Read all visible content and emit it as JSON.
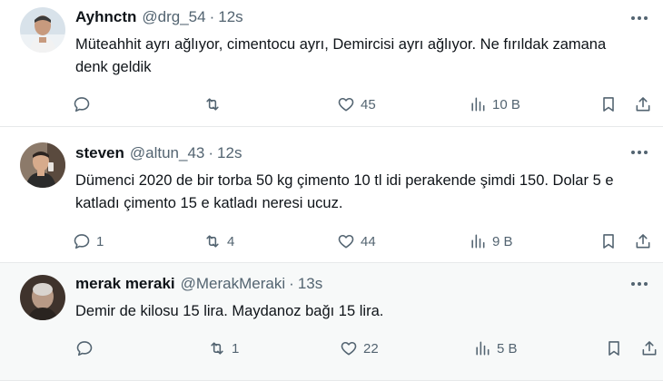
{
  "tweets": [
    {
      "name": "Ayhnctn",
      "handle": "@drg_54",
      "dot": "·",
      "time": "12s",
      "text": "Müteahhit ayrı ağlıyor, cimentocu ayrı, Demircisi ayrı ağlıyor. Ne fırıldak zamana denk geldik",
      "replies": "",
      "retweets": "",
      "likes": "45",
      "views": "10 B",
      "avatar_color": "#c9d3db"
    },
    {
      "name": "steven",
      "handle": "@altun_43",
      "dot": "·",
      "time": "12s",
      "text": "Dümenci 2020 de bir torba 50 kg çimento 10 tl idi perakende şimdi 150. Dolar 5 e katladı çimento 15 e katladı neresi ucuz.",
      "replies": "1",
      "retweets": "4",
      "likes": "44",
      "views": "9 B",
      "avatar_color": "#6b5a4c"
    },
    {
      "name": "merak meraki",
      "handle": "@MerakMeraki",
      "dot": "·",
      "time": "13s",
      "text": "Demir de kilosu 15 lira. Maydanoz bağı 15 lira.",
      "replies": "",
      "retweets": "1",
      "likes": "22",
      "views": "5 B",
      "avatar_color": "#4a3b33"
    }
  ],
  "colors": {
    "text": "#0f1419",
    "muted": "#536471",
    "divider": "#e7e9ea",
    "highlight_bg": "#f7f9f9"
  },
  "icons": {
    "more": "more-horizontal-icon",
    "reply": "reply-icon",
    "retweet": "retweet-icon",
    "like": "heart-icon",
    "views": "views-chart-icon",
    "bookmark": "bookmark-icon",
    "share": "share-icon"
  }
}
